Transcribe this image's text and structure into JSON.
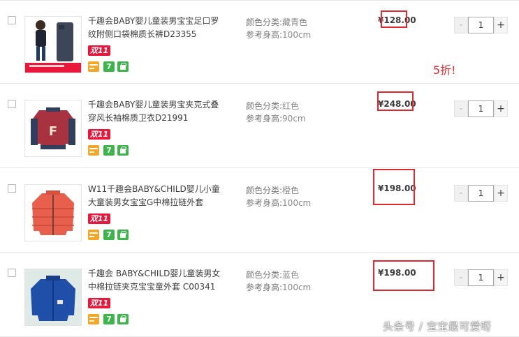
{
  "note_annotation": "5折!",
  "watermark": "头条号 / 宝宝最可爱呀",
  "labels": {
    "color_label": "颜色分类:",
    "height_label": "参考身高:",
    "double11": "双11",
    "icon7": "7",
    "minus": "-",
    "plus": "+"
  },
  "items": [
    {
      "title": "千趣会BABY婴儿童装男宝宝足口罗纹附侧口袋棉质长裤D23355",
      "color": "藏青色",
      "height": "100cm",
      "price": "¥128.00",
      "qty": "1"
    },
    {
      "title": "千趣会BABY婴儿童装男宝夹克式叠穿风长袖棉质卫衣D21991",
      "color": "红色",
      "height": "90cm",
      "price": "¥248.00",
      "qty": "1"
    },
    {
      "title": "W11千趣会BABY&CHILD婴儿小童大童装男女宝宝G中棉拉链外套",
      "color": "橙色",
      "height": "100cm",
      "price": "¥198.00",
      "qty": "1"
    },
    {
      "title": "千趣会 BABY&CHILD婴儿童装男女中棉拉链夹克宝宝童外套 C00341",
      "color": "蓝色",
      "height": "100cm",
      "price": "¥198.00",
      "qty": "1"
    }
  ],
  "colors": {
    "accent_red": "#e0282e",
    "badge_red": "#e8173b",
    "icon_green": "#3cb64a",
    "icon_orange": "#f5a623"
  },
  "icons": [
    "checkbox-icon",
    "card-icon",
    "seven-day-return-icon",
    "shopping-bag-icon"
  ]
}
